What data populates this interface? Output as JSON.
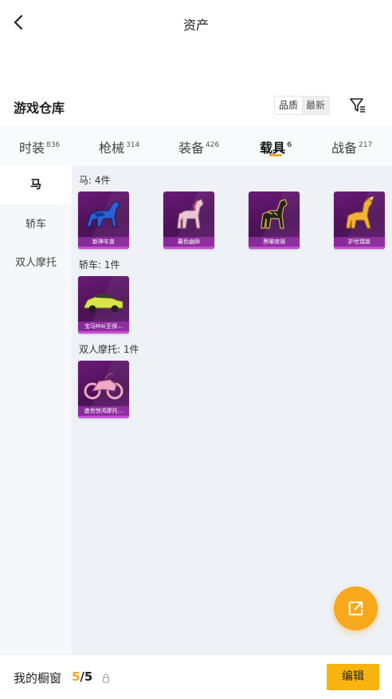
{
  "header": {
    "title": "资产"
  },
  "warehouse": {
    "title": "游戏仓库",
    "sort_options": [
      "品质",
      "最新"
    ]
  },
  "tabs": [
    {
      "label": "时装",
      "count": "836"
    },
    {
      "label": "枪械",
      "count": "314"
    },
    {
      "label": "装备",
      "count": "426"
    },
    {
      "label": "载具",
      "count": "6"
    },
    {
      "label": "战备",
      "count": "217"
    }
  ],
  "active_tab": "载具",
  "sidebar": {
    "items": [
      {
        "label": "马"
      },
      {
        "label": "轿车"
      },
      {
        "label": "双人摩托"
      }
    ],
    "active": "马"
  },
  "sections": [
    {
      "label": "马: 4件",
      "items": [
        {
          "name": "新神车兽",
          "icon": "horse-icon",
          "color": "#2a5fd6"
        },
        {
          "name": "暮色幽蹄",
          "icon": "horse-icon",
          "color": "#e8c6d3"
        },
        {
          "name": "黑曜夜骑",
          "icon": "horse-icon",
          "color": "#222222"
        },
        {
          "name": "护世瑞兽",
          "icon": "horse-icon",
          "color": "#f2b233"
        }
      ]
    },
    {
      "label": "轿车: 1件",
      "items": [
        {
          "name": "宝马M4(至保...",
          "icon": "car-icon",
          "color": "#d9e54a"
        }
      ]
    },
    {
      "label": "双人摩托: 1件",
      "items": [
        {
          "name": "盛世惊鸿摩托...",
          "icon": "motorcycle-icon",
          "color": "#f0a8c4"
        }
      ]
    }
  ],
  "showcase": {
    "label": "我的橱窗",
    "current": "5",
    "separator": "/",
    "total": "5"
  },
  "actions": {
    "edit_label": "编辑"
  },
  "colors": {
    "accent": "#f7b40f",
    "card": "#5a1668"
  }
}
